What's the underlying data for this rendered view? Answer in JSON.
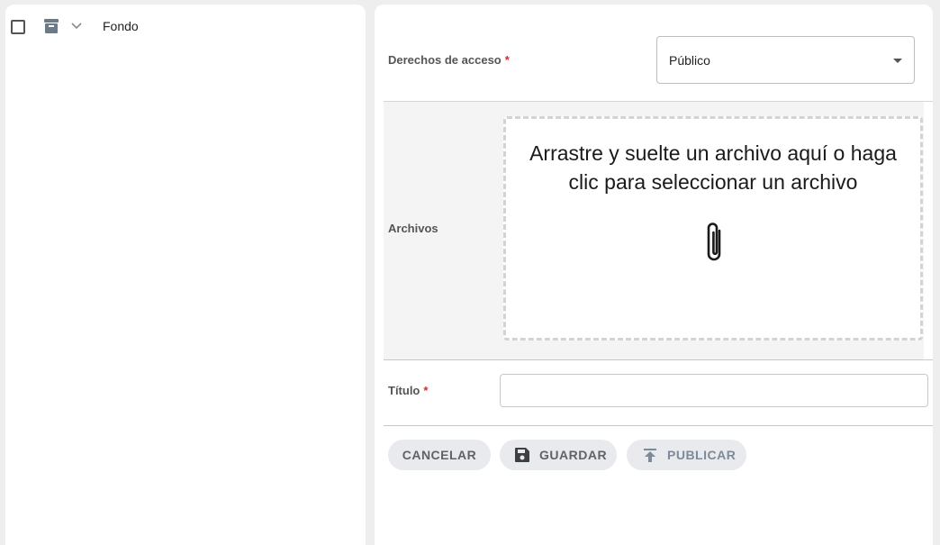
{
  "tree": {
    "node_label": "Fondo"
  },
  "form": {
    "access": {
      "label": "Derechos de acceso",
      "required_mark": "*",
      "value": "Público"
    },
    "files": {
      "label": "Archivos",
      "dropzone_text": "Arrastre y suelte un archivo aquí o haga clic para seleccionar un archivo"
    },
    "title": {
      "label": "Título",
      "required_mark": "*",
      "value": ""
    }
  },
  "actions": {
    "cancel_label": "CANCELAR",
    "save_label": "GUARDAR",
    "publish_label": "PUBLICAR"
  },
  "icons": {
    "archive": "archive-icon",
    "chevron": "chevron-down-icon",
    "paperclip": "paperclip-icon",
    "save": "floppy-disk-icon",
    "publish": "upload-icon"
  }
}
